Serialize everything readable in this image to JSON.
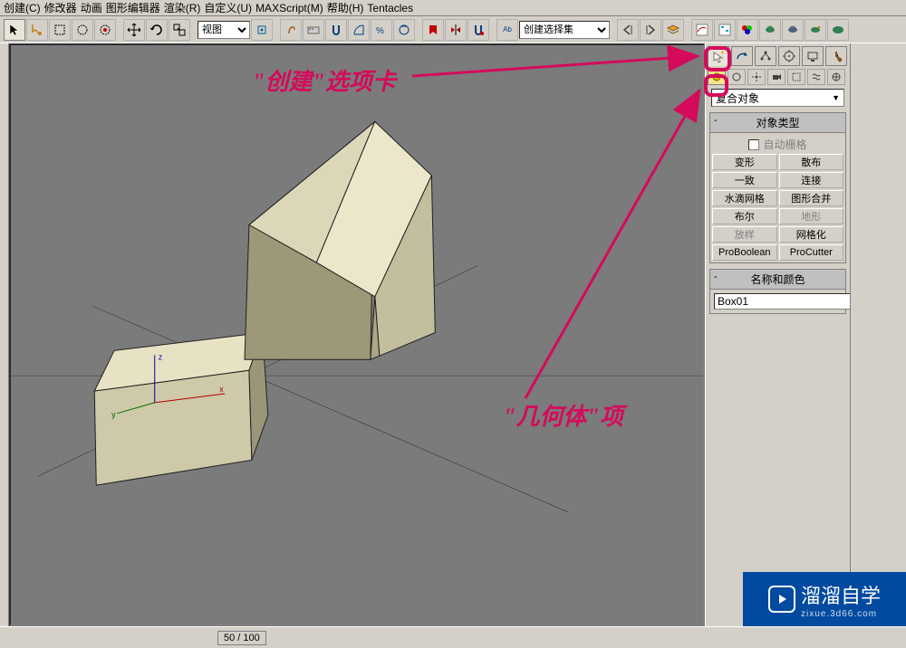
{
  "menu": {
    "items": [
      "创建(C)",
      "修改器",
      "动画",
      "图形编辑器",
      "渲染(R)",
      "自定义(U)",
      "MAXScript(M)",
      "帮助(H)",
      "Tentacles"
    ]
  },
  "toolbar": {
    "view_label": "视图",
    "select_set": "创建选择集"
  },
  "panel": {
    "category": "复合对象",
    "rollout1_title": "对象类型",
    "autogrid": "自动栅格",
    "buttons": [
      {
        "label": "变形",
        "disabled": false
      },
      {
        "label": "散布",
        "disabled": false
      },
      {
        "label": "一致",
        "disabled": false
      },
      {
        "label": "连接",
        "disabled": false
      },
      {
        "label": "水滴网格",
        "disabled": false
      },
      {
        "label": "图形合并",
        "disabled": false
      },
      {
        "label": "布尔",
        "disabled": false
      },
      {
        "label": "地形",
        "disabled": true
      },
      {
        "label": "放样",
        "disabled": true
      },
      {
        "label": "网格化",
        "disabled": false
      },
      {
        "label": "ProBoolean",
        "disabled": false
      },
      {
        "label": "ProCutter",
        "disabled": false
      }
    ],
    "rollout2_title": "名称和颜色",
    "object_name": "Box01"
  },
  "callouts": {
    "create_tab": "\"创建\"选项卡",
    "geometry": "\"几何体\"项"
  },
  "status": {
    "frame": "50 / 100"
  },
  "watermark": {
    "brand": "溜溜自学",
    "url": "zixue.3d66.com"
  }
}
